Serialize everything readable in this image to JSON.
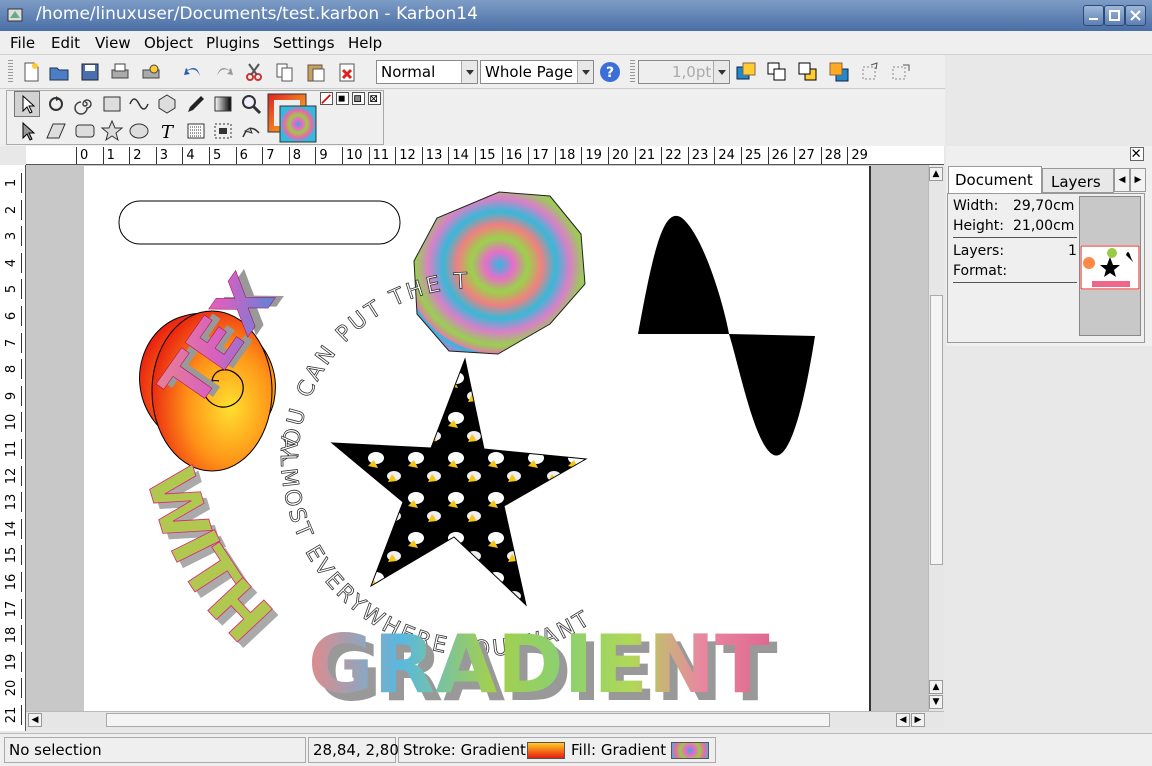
{
  "window": {
    "title": "/home/linuxuser/Documents/test.karbon - Karbon14"
  },
  "menu": [
    "File",
    "Edit",
    "View",
    "Object",
    "Plugins",
    "Settings",
    "Help"
  ],
  "toolbar": {
    "blend_mode": "Normal",
    "zoom": "Whole Page",
    "stroke_width": "1,0pt"
  },
  "ruler": {
    "h_ticks": [
      "0",
      "1",
      "2",
      "3",
      "4",
      "5",
      "6",
      "7",
      "8",
      "9",
      "10",
      "11",
      "12",
      "13",
      "14",
      "15",
      "16",
      "17",
      "18",
      "19",
      "20",
      "21",
      "22",
      "23",
      "24",
      "25",
      "26",
      "27",
      "28",
      "29"
    ],
    "v_ticks": [
      "1",
      "2",
      "3",
      "4",
      "5",
      "6",
      "7",
      "8",
      "9",
      "10",
      "11",
      "12",
      "13",
      "14",
      "15",
      "16",
      "17",
      "18",
      "19",
      "20",
      "21"
    ]
  },
  "canvas": {
    "path_text_top": "YOU CAN PUT THE TEXT",
    "path_text_bottom": "ALMOST EVERYWHERE YOU WANT",
    "word_with": "WITH",
    "word_gradient": "GRADIENT"
  },
  "docker": {
    "tabs": [
      "Document",
      "Layers"
    ],
    "width_label": "Width:",
    "width_value": "29,70cm",
    "height_label": "Height:",
    "height_value": "21,00cm",
    "layers_label": "Layers:",
    "layers_value": "1",
    "format_label": "Format:",
    "format_value": ""
  },
  "status": {
    "selection": "No selection",
    "coords": "28,84, 2,80",
    "stroke": "Stroke: Gradient",
    "fill": "Fill: Gradient"
  }
}
